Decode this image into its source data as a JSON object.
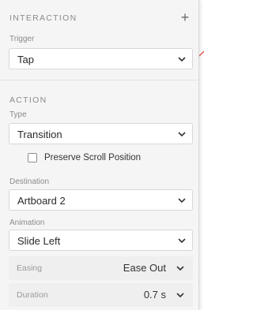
{
  "interaction": {
    "title": "INTERACTION",
    "add_icon": "plus-icon",
    "trigger_label": "Trigger",
    "trigger_value": "Tap"
  },
  "action": {
    "title": "ACTION",
    "type_label": "Type",
    "type_value": "Transition",
    "preserve_scroll_label": "Preserve Scroll Position",
    "preserve_scroll_checked": false,
    "destination_label": "Destination",
    "destination_value": "Artboard 2",
    "animation_label": "Animation",
    "animation_value": "Slide Left",
    "easing_label": "Easing",
    "easing_value": "Ease Out",
    "duration_label": "Duration",
    "duration_value": "0.7 s"
  },
  "colors": {
    "panel_bg": "#f5f5f5",
    "field_bg": "#ffffff",
    "label_text": "#8a8a8a",
    "edge_accent": "#e0463a"
  }
}
